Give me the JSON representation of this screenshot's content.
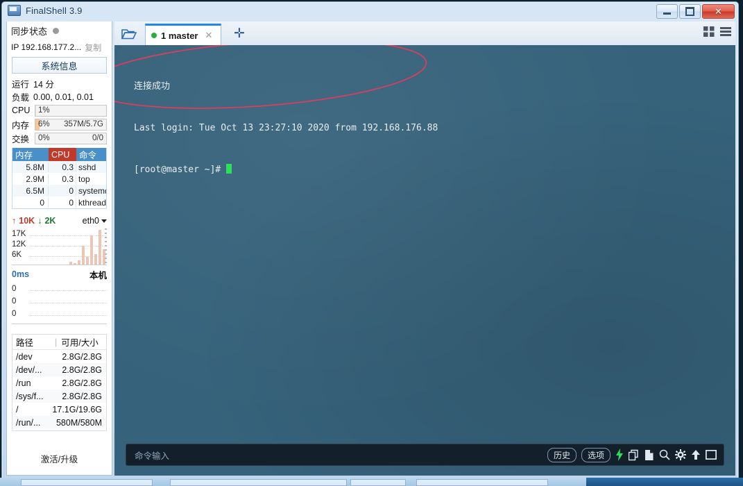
{
  "window": {
    "title": "FinalShell 3.9",
    "app_icon": "monitor-icon",
    "minimize_label": "",
    "maximize_label": "",
    "close_label": "✕"
  },
  "sidebar": {
    "sync_status_label": "同步状态",
    "sync_status_state": "idle",
    "ip_label": "IP 192.168.177.2...",
    "copy_label": "复制",
    "system_info_button": "系统信息",
    "uptime": {
      "key": "运行",
      "value": "14 分"
    },
    "load": {
      "key": "负载",
      "value": "0.00, 0.01, 0.01"
    },
    "meters": [
      {
        "key": "CPU",
        "percent": "1%",
        "fill": 1,
        "right": "",
        "color": "#cfe8cb"
      },
      {
        "key": "内存",
        "percent": "6%",
        "fill": 6,
        "right": "357M/5.7G",
        "color": "#f7c894"
      },
      {
        "key": "交换",
        "percent": "0%",
        "fill": 0,
        "right": "0/0",
        "color": "#e9e9e9"
      }
    ],
    "process_table": {
      "headers": {
        "mem": "内存",
        "cpu": "CPU",
        "cmd": "命令"
      },
      "header_colors": {
        "mem": "#4a90c8",
        "cpu": "#c0392b",
        "cmd": "#4a90c8"
      },
      "rows": [
        {
          "mem": "5.8M",
          "cpu": "0.3",
          "cmd": "sshd"
        },
        {
          "mem": "2.9M",
          "cpu": "0.3",
          "cmd": "top"
        },
        {
          "mem": "6.5M",
          "cpu": "0",
          "cmd": "systemd"
        },
        {
          "mem": "0",
          "cpu": "0",
          "cmd": "kthreadd"
        }
      ]
    },
    "network": {
      "upload": "10K",
      "download": "2K",
      "interface": "eth0",
      "y_labels": [
        "17K",
        "12K",
        "6K"
      ],
      "bars": [
        3,
        2,
        5,
        22,
        9,
        34,
        12,
        40,
        18
      ]
    },
    "ping": {
      "latency": "0ms",
      "host": "本机",
      "y_labels": [
        "0",
        "0",
        "0"
      ]
    },
    "disks": {
      "headers": {
        "path": "路径",
        "size": "可用/大小"
      },
      "rows": [
        {
          "path": "/dev",
          "size": "2.8G/2.8G"
        },
        {
          "path": "/dev/...",
          "size": "2.8G/2.8G"
        },
        {
          "path": "/run",
          "size": "2.8G/2.8G"
        },
        {
          "path": "/sys/f...",
          "size": "2.8G/2.8G"
        },
        {
          "path": "/",
          "size": "17.1G/19.6G"
        },
        {
          "path": "/run/...",
          "size": "580M/580M"
        }
      ]
    },
    "activate_label": "激活/升级"
  },
  "tabbar": {
    "folder_icon": "open-folder-icon",
    "tabs": [
      {
        "label": "1 master",
        "status_color": "#27b03a",
        "close": "✕",
        "active": true
      }
    ],
    "add_tab_label": "✛",
    "grid_view_icon": "grid-view-icon",
    "list_view_icon": "list-view-icon"
  },
  "terminal": {
    "background": "#36627b",
    "lines": [
      "连接成功",
      "Last login: Tue Oct 13 23:27:10 2020 from 192.168.176.88",
      "[root@master ~]# "
    ],
    "cursor_color": "#2de05a",
    "annotation": {
      "shape": "ellipse",
      "color": "#d6405e"
    }
  },
  "command_bar": {
    "placeholder": "命令输入",
    "history_label": "历史",
    "options_label": "选项",
    "icons": [
      "lightning-icon",
      "copy-icon",
      "paste-icon",
      "search-icon",
      "gear-icon",
      "upload-arrow-icon",
      "window-icon"
    ]
  }
}
